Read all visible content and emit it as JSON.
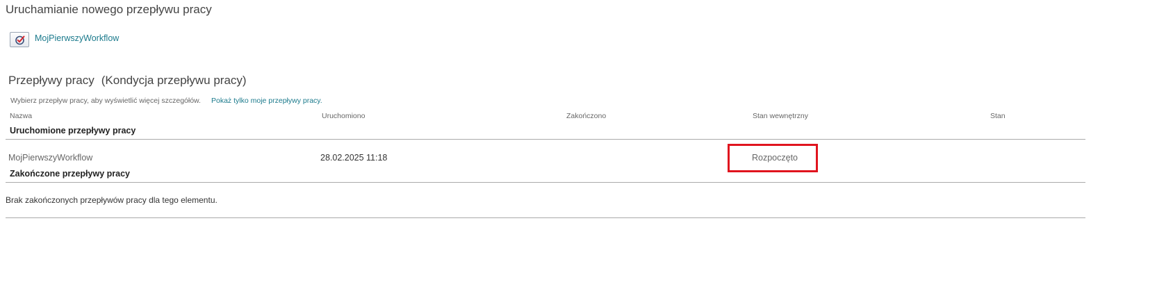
{
  "page": {
    "title": "Uruchamianie nowego przepływu pracy"
  },
  "start_workflow": {
    "icon": "workflow-start-icon",
    "link_label": "MojPierwszyWorkflow"
  },
  "workflows": {
    "title": "Przepływy pracy",
    "subtitle": "(Kondycja przepływu pracy)",
    "hint": "Wybierz przepływ pracy, aby wyświetlić więcej szczegółów.",
    "hint_link": "Pokaż tylko moje przepływy pracy.",
    "columns": {
      "name": "Nazwa",
      "started": "Uruchomiono",
      "ended": "Zakończono",
      "internal_status": "Stan wewnętrzny",
      "status": "Stan"
    },
    "running": {
      "label": "Uruchomione przepływy pracy",
      "rows": [
        {
          "name": "MojPierwszyWorkflow",
          "started": "28.02.2025 11:18",
          "ended": "",
          "internal_status": "Rozpoczęto",
          "status": ""
        }
      ]
    },
    "completed": {
      "label": "Zakończone przepływy pracy",
      "empty_message": "Brak zakończonych przepływów pracy dla tego elementu."
    }
  },
  "colors": {
    "link": "#1b7a8c",
    "highlight_box": "#e0141e",
    "divider": "#aaaaaa"
  }
}
